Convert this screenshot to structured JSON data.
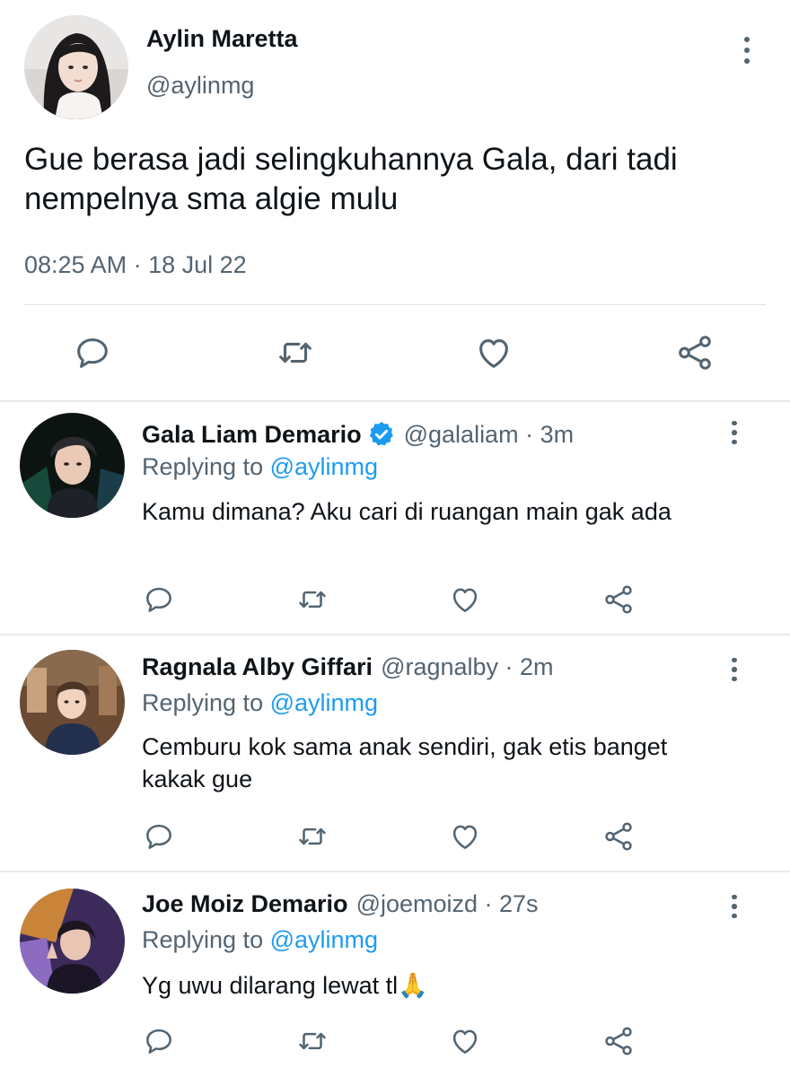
{
  "main_tweet": {
    "author_name": "Aylin Maretta",
    "author_handle": "@aylinmg",
    "text": "Gue berasa jadi selingkuhannya Gala, dari tadi nempelnya sma algie mulu",
    "time": "08:25 AM",
    "separator": "·",
    "date": "18 Jul 22",
    "actions": [
      "reply-icon",
      "retweet-icon",
      "like-icon",
      "share-icon"
    ]
  },
  "replies": [
    {
      "name": "Gala Liam Demario",
      "verified": true,
      "handle_line": "@galaliam · 3m",
      "replying_prefix": "Replying to",
      "replying_to": "@aylinmg",
      "text": "Kamu dimana? Aku cari di ruangan main gak ada"
    },
    {
      "name": "Ragnala Alby Giffari",
      "verified": false,
      "handle_line": "@ragnalby · 2m",
      "replying_prefix": "Replying to",
      "replying_to": "@aylinmg",
      "text": "Cemburu kok sama anak sendiri, gak etis banget kakak gue"
    },
    {
      "name": "Joe Moiz Demario",
      "verified": false,
      "handle_line": "@joemoizd · 27s",
      "replying_prefix": "Replying to",
      "replying_to": "@aylinmg",
      "text": "Yg uwu dilarang lewat tl🙏"
    }
  ],
  "colors": {
    "text_primary": "#0f1419",
    "text_secondary": "#536471",
    "accent_blue": "#1d9bf0",
    "divider": "#e7eaed"
  }
}
